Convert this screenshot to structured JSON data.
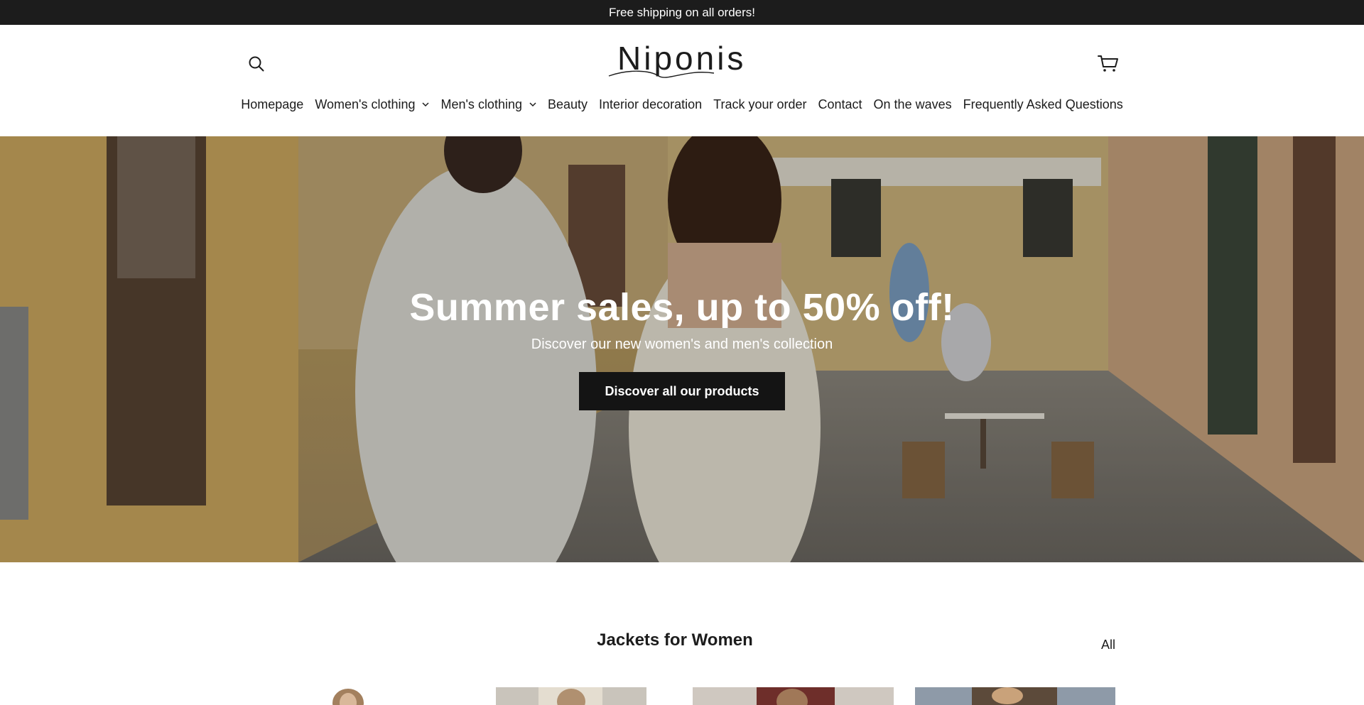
{
  "announcement": {
    "text": "Free shipping on all orders!"
  },
  "header": {
    "logo_text": "Niponis",
    "search_icon": "search-icon",
    "cart_icon": "cart-icon"
  },
  "nav": {
    "items": [
      {
        "label": "Homepage",
        "has_dropdown": false
      },
      {
        "label": "Women's clothing",
        "has_dropdown": true
      },
      {
        "label": "Men's clothing",
        "has_dropdown": true
      },
      {
        "label": "Beauty",
        "has_dropdown": false
      },
      {
        "label": "Interior decoration",
        "has_dropdown": false
      },
      {
        "label": "Track your order",
        "has_dropdown": false
      },
      {
        "label": "Contact",
        "has_dropdown": false
      },
      {
        "label": "On the waves",
        "has_dropdown": false
      },
      {
        "label": "Frequently Asked Questions",
        "has_dropdown": false
      }
    ]
  },
  "hero": {
    "title": "Summer sales, up to 50% off!",
    "subtitle": "Discover our new women's and men's collection",
    "button_label": "Discover all our products"
  },
  "collection": {
    "title": "Jackets for Women",
    "view_all_label": "All"
  },
  "colors": {
    "announcement_bg": "#1c1c1c",
    "button_bg": "#141414",
    "text": "#1c1c1c"
  }
}
